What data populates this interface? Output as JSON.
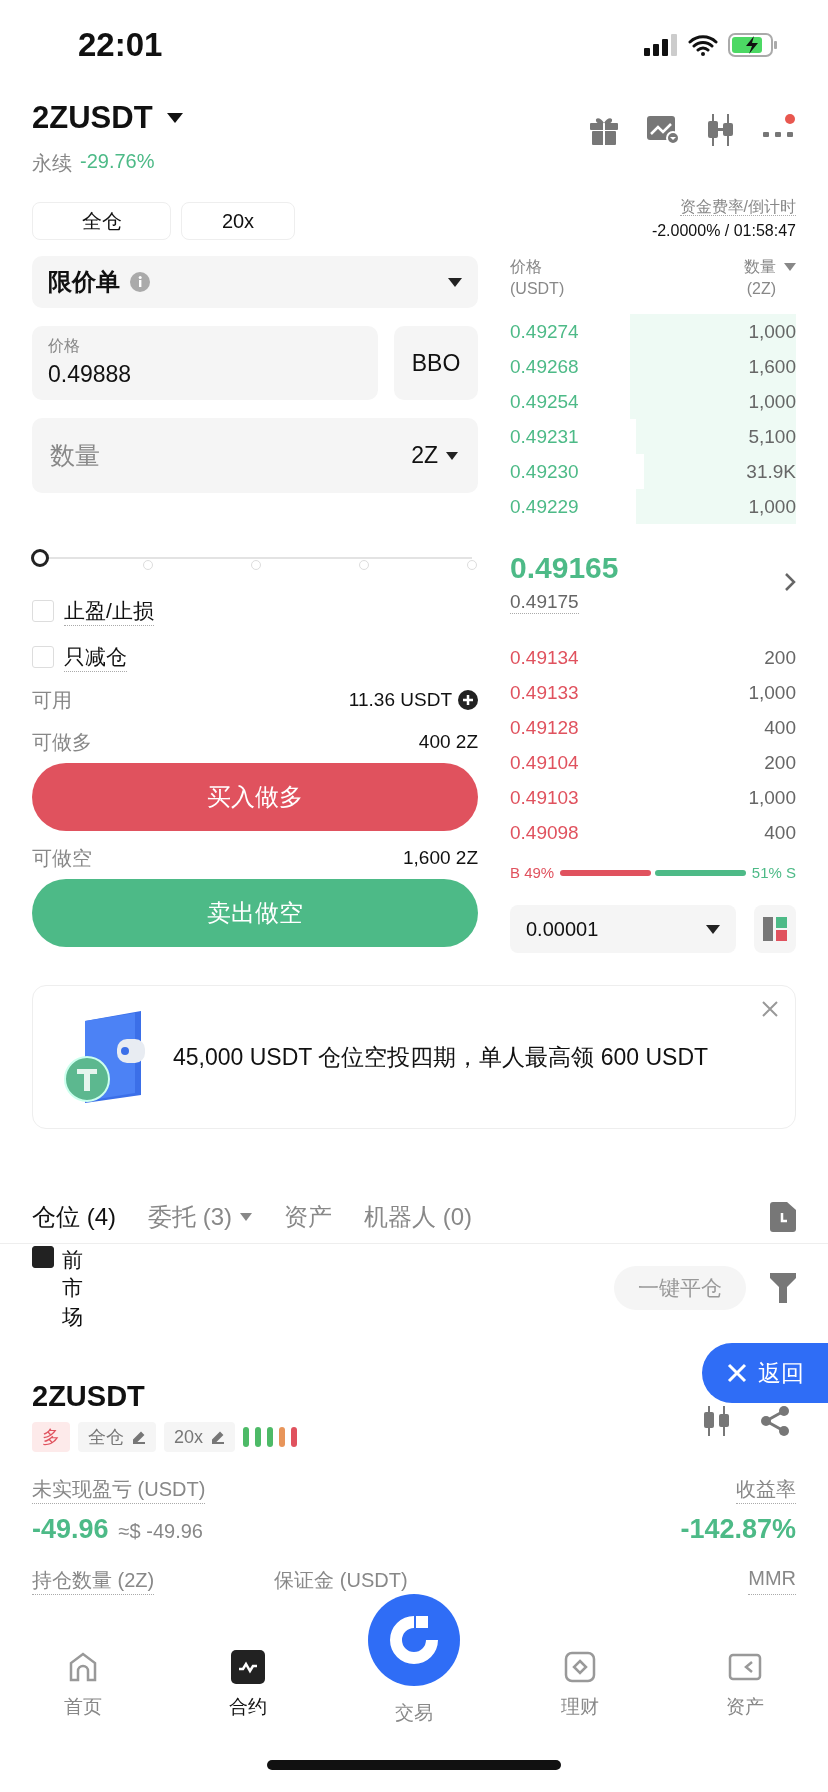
{
  "status_bar": {
    "time": "22:01"
  },
  "header": {
    "symbol": "2ZUSDT",
    "type": "永续",
    "change": "-29.76%"
  },
  "margin": {
    "mode": "全仓",
    "leverage": "20x"
  },
  "funding": {
    "label": "资金费率/倒计时",
    "value": "-2.0000% / 01:58:47"
  },
  "order_form": {
    "order_type": "限价单",
    "price_label": "价格",
    "price_value": "0.49888",
    "bbo": "BBO",
    "quantity_placeholder": "数量",
    "quantity_unit": "2Z",
    "slider": {
      "level": 0
    },
    "options": [
      {
        "label": "止盈/止损",
        "checked": false
      },
      {
        "label": "只减仓",
        "checked": false
      }
    ],
    "available_label": "可用",
    "available_value": "11.36 USDT",
    "long_label": "可做多",
    "long_value": "400 2Z",
    "buy_button": "买入做多",
    "short_label": "可做空",
    "short_value": "1,600 2Z",
    "sell_button": "卖出做空"
  },
  "order_book": {
    "price_header": "价格",
    "price_unit": "(USDT)",
    "qty_header": "数量",
    "qty_unit": "(2Z)",
    "asks": [
      {
        "price": "0.49274",
        "qty": "1,000"
      },
      {
        "price": "0.49268",
        "qty": "1,600"
      },
      {
        "price": "0.49254",
        "qty": "1,000"
      },
      {
        "price": "0.49231",
        "qty": "5,100"
      },
      {
        "price": "0.49230",
        "qty": "31.9K"
      },
      {
        "price": "0.49229",
        "qty": "1,000"
      }
    ],
    "last_price": "0.49165",
    "mark_price": "0.49175",
    "bids": [
      {
        "price": "0.49134",
        "qty": "200"
      },
      {
        "price": "0.49133",
        "qty": "1,000"
      },
      {
        "price": "0.49128",
        "qty": "400"
      },
      {
        "price": "0.49104",
        "qty": "200"
      },
      {
        "price": "0.49103",
        "qty": "1,000"
      },
      {
        "price": "0.49098",
        "qty": "400"
      }
    ],
    "buy_share": "B 49%",
    "sell_share": "51% S",
    "precision": "0.00001"
  },
  "banner": {
    "text": "45,000 USDT 仓位空投四期，单人最高领 600 USDT"
  },
  "tabs": [
    {
      "label": "仓位 (4)",
      "selected": true,
      "dropdown": false
    },
    {
      "label": "委托 (3)",
      "selected": false,
      "dropdown": true
    },
    {
      "label": "资产",
      "selected": false,
      "dropdown": false
    },
    {
      "label": "机器人 (0)",
      "selected": false,
      "dropdown": false
    }
  ],
  "positions": {
    "filter": {
      "label": "前市场",
      "checked": true
    },
    "close_all": {
      "label": "一键平仓",
      "disabled": true
    },
    "symbol": "2ZUSDT",
    "side_tag": "多",
    "margin_tag": "全仓",
    "leverage_tag": "20x",
    "pnl_label": "未实现盈亏 (USDT)",
    "pnl_value": "-49.96",
    "pnl_usd": "≈$ -49.96",
    "roe_label": "收益率",
    "roe_value": "-142.87%",
    "size_label": "持仓数量 (2Z)",
    "margin_label": "保证金 (USDT)",
    "mmr_label": "MMR"
  },
  "floating_back": "返回",
  "nav": [
    {
      "label": "首页",
      "selected": false,
      "kind": "home"
    },
    {
      "label": "合约",
      "selected": true,
      "kind": "futures"
    },
    {
      "label": "交易",
      "selected": false,
      "kind": "trade"
    },
    {
      "label": "理财",
      "selected": false,
      "kind": "earn"
    },
    {
      "label": "资产",
      "selected": false,
      "kind": "assets"
    }
  ]
}
